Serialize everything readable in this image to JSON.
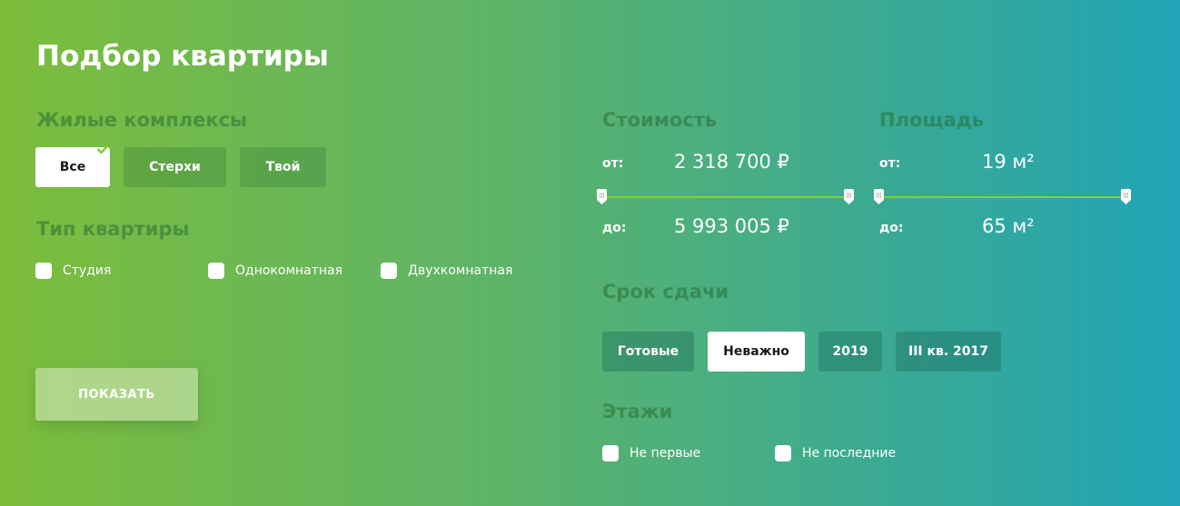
{
  "page": {
    "title": "Подбор квартиры"
  },
  "complexes": {
    "heading": "Жилые комплексы",
    "options": [
      {
        "label": "Все",
        "selected": true
      },
      {
        "label": "Стерхи",
        "selected": false
      },
      {
        "label": "Твой",
        "selected": false
      }
    ]
  },
  "apartment_type": {
    "heading": "Тип квартиры",
    "options": [
      {
        "label": "Студия",
        "checked": false
      },
      {
        "label": "Однокомнатная",
        "checked": false
      },
      {
        "label": "Двухкомнатная",
        "checked": false
      }
    ]
  },
  "show_button": {
    "label": "ПОКАЗАТЬ"
  },
  "price": {
    "heading": "Стоимость",
    "from_label": "от:",
    "from_value": "2 318 700 ₽",
    "to_label": "до:",
    "to_value": "5 993 005 ₽"
  },
  "area": {
    "heading": "Площадь",
    "from_label": "от:",
    "from_value": "19 м²",
    "to_label": "до:",
    "to_value": "65 м²"
  },
  "deadline": {
    "heading": "Срок сдачи",
    "options": [
      {
        "label": "Готовые",
        "selected": false
      },
      {
        "label": "Неважно",
        "selected": true
      },
      {
        "label": "2019",
        "selected": false
      },
      {
        "label": "III кв. 2017",
        "selected": false
      }
    ]
  },
  "floors": {
    "heading": "Этажи",
    "options": [
      {
        "label": "Не первые",
        "checked": false
      },
      {
        "label": "Не последние",
        "checked": false
      }
    ]
  },
  "colors": {
    "gradient_start": "#7dbd3b",
    "gradient_end": "#22a5b7",
    "slider_track": "#7ed332",
    "check_accent": "#7ed332"
  }
}
